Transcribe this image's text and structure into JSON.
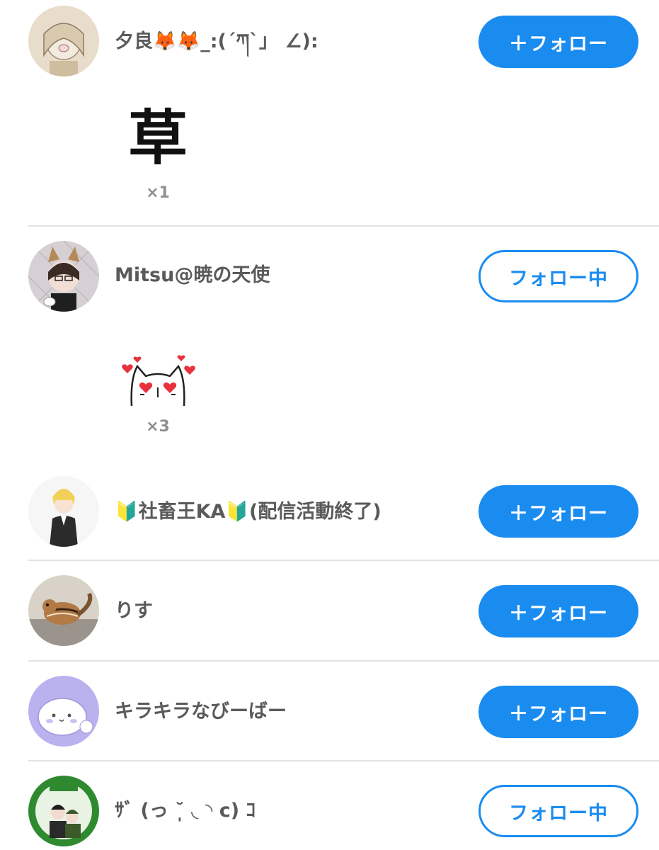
{
  "users": [
    {
      "name": "夕良🦊🦊_:(´ཀ`」 ∠):",
      "button": "＋フォロー",
      "avatar": "anime-girl-pig-sketch-avatar"
    },
    {
      "name": "Mitsu@暁の天使",
      "button": "フォロー中",
      "avatar": "cat-ear-glasses-avatar"
    },
    {
      "name": "🔰社畜王KA🔰(配信活動終了)",
      "button": "＋フォロー",
      "avatar": "blonde-boy-avatar"
    },
    {
      "name": "りす",
      "button": "＋フォロー",
      "avatar": "chipmunk-photo-avatar"
    },
    {
      "name": "キラキラなびーばー",
      "button": "＋フォロー",
      "avatar": "white-seal-avatar"
    },
    {
      "name": "ｻﾞ (っ ˘̩̩̩ ◟ ◝ c) ｺ",
      "button": "フォロー中",
      "avatar": "green-badge-avatar"
    }
  ],
  "stamps": [
    {
      "text": "草",
      "count": "×1",
      "icon": "kusa-stamp"
    },
    {
      "count": "×3",
      "icon": "heart-eyes-cat-stamp"
    }
  ],
  "colors": {
    "accent": "#1a8cf0",
    "divider": "#e2e2e2"
  }
}
